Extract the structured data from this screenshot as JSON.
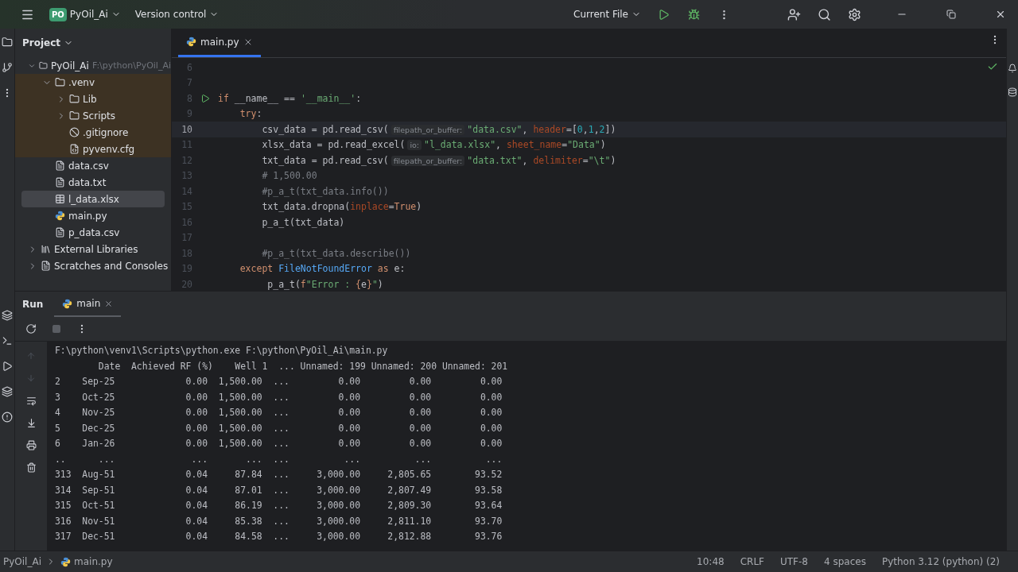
{
  "title_bar": {
    "project_badge": "PO",
    "project": "PyOil_Ai",
    "vcs": "Version control",
    "run_config": "Current File"
  },
  "project_panel": {
    "title": "Project",
    "tree": [
      {
        "label": "PyOil_Ai",
        "path": "F:\\python\\PyOil_Ai",
        "kind": "folder",
        "expanded": true,
        "selected": false,
        "excluded": false,
        "children": [
          {
            "label": ".venv",
            "kind": "folder",
            "expanded": true,
            "selected": false,
            "excluded": true,
            "children": [
              {
                "label": "Lib",
                "kind": "folder",
                "expanded": false,
                "selected": false,
                "excluded": true
              },
              {
                "label": "Scripts",
                "kind": "folder",
                "expanded": false,
                "selected": false,
                "excluded": true
              },
              {
                "label": ".gitignore",
                "kind": "ignore",
                "selected": false,
                "excluded": true
              },
              {
                "label": "pyvenv.cfg",
                "kind": "cfg",
                "selected": false,
                "excluded": true
              }
            ]
          },
          {
            "label": "data.csv",
            "kind": "text",
            "selected": false,
            "excluded": false
          },
          {
            "label": "data.txt",
            "kind": "text",
            "selected": false,
            "excluded": false
          },
          {
            "label": "l_data.xlsx",
            "kind": "table",
            "selected": true,
            "excluded": false
          },
          {
            "label": "main.py",
            "kind": "python",
            "selected": false,
            "excluded": false
          },
          {
            "label": "p_data.csv",
            "kind": "text",
            "selected": false,
            "excluded": false
          }
        ]
      },
      {
        "label": "External Libraries",
        "kind": "library",
        "expanded": false,
        "selected": false,
        "excluded": false
      },
      {
        "label": "Scratches and Consoles",
        "kind": "scratch",
        "expanded": false,
        "selected": false,
        "excluded": false
      }
    ]
  },
  "editor": {
    "tabs": [
      {
        "label": "main.py",
        "selected": true
      }
    ],
    "lines": [
      {
        "number": "6",
        "current": false,
        "run": false
      },
      {
        "number": "7",
        "current": false,
        "run": false
      },
      {
        "number": "8",
        "current": false,
        "run": true,
        "tokens": [
          {
            "kind": "kw",
            "text": "if "
          },
          {
            "kind": "plain",
            "text": "__name__ == "
          },
          {
            "kind": "str",
            "text": "'__main__'"
          },
          {
            "kind": "plain",
            "text": ":"
          }
        ]
      },
      {
        "number": "9",
        "current": false,
        "run": false,
        "tokens": [
          {
            "kind": "kw",
            "text": "    try"
          },
          {
            "kind": "plain",
            "text": ":"
          }
        ]
      },
      {
        "number": "10",
        "current": true,
        "run": false,
        "tokens": [
          {
            "kind": "plain",
            "text": "        csv_data = pd.read_csv("
          },
          {
            "kind": "hint",
            "text": "filepath_or_buffer:"
          },
          {
            "kind": "str",
            "text": "\"data.csv\""
          },
          {
            "kind": "plain",
            "text": ", "
          },
          {
            "kind": "param",
            "text": "header"
          },
          {
            "kind": "plain",
            "text": "=["
          },
          {
            "kind": "num",
            "text": "0"
          },
          {
            "kind": "plain",
            "text": ","
          },
          {
            "kind": "num",
            "text": "1"
          },
          {
            "kind": "plain",
            "text": ","
          },
          {
            "kind": "num",
            "text": "2"
          },
          {
            "kind": "plain",
            "text": "])"
          }
        ]
      },
      {
        "number": "11",
        "current": false,
        "run": false,
        "tokens": [
          {
            "kind": "plain",
            "text": "        xlsx_data = pd.read_excel("
          },
          {
            "kind": "hint",
            "text": "io:"
          },
          {
            "kind": "str",
            "text": "\"l_data.xlsx\""
          },
          {
            "kind": "plain",
            "text": ", "
          },
          {
            "kind": "param",
            "text": "sheet_name"
          },
          {
            "kind": "plain",
            "text": "="
          },
          {
            "kind": "str",
            "text": "\"Data\""
          },
          {
            "kind": "plain",
            "text": ")"
          }
        ]
      },
      {
        "number": "12",
        "current": false,
        "run": false,
        "tokens": [
          {
            "kind": "plain",
            "text": "        txt_data = pd.read_csv("
          },
          {
            "kind": "hint",
            "text": "filepath_or_buffer:"
          },
          {
            "kind": "str",
            "text": "\"data.txt\""
          },
          {
            "kind": "plain",
            "text": ", "
          },
          {
            "kind": "param",
            "text": "delimiter"
          },
          {
            "kind": "plain",
            "text": "="
          },
          {
            "kind": "str",
            "text": "\"\\t\""
          },
          {
            "kind": "plain",
            "text": ")"
          }
        ]
      },
      {
        "number": "13",
        "current": false,
        "run": false,
        "tokens": [
          {
            "kind": "comment",
            "text": "        # 1,500.00"
          }
        ]
      },
      {
        "number": "14",
        "current": false,
        "run": false,
        "tokens": [
          {
            "kind": "comment",
            "text": "        #p_a_t(txt_data.info())"
          }
        ]
      },
      {
        "number": "15",
        "current": false,
        "run": false,
        "tokens": [
          {
            "kind": "plain",
            "text": "        txt_data.dropna("
          },
          {
            "kind": "param",
            "text": "inplace"
          },
          {
            "kind": "plain",
            "text": "="
          },
          {
            "kind": "kw",
            "text": "True"
          },
          {
            "kind": "plain",
            "text": ")"
          }
        ]
      },
      {
        "number": "16",
        "current": false,
        "run": false,
        "tokens": [
          {
            "kind": "plain",
            "text": "        p_a_t(txt_data)"
          }
        ]
      },
      {
        "number": "17",
        "current": false,
        "run": false
      },
      {
        "number": "18",
        "current": false,
        "run": false,
        "tokens": [
          {
            "kind": "comment",
            "text": "        #p_a_t(txt_data.describe())"
          }
        ]
      },
      {
        "number": "19",
        "current": false,
        "run": false,
        "tokens": [
          {
            "kind": "kw",
            "text": "    except "
          },
          {
            "kind": "cls",
            "text": "FileNotFoundError"
          },
          {
            "kind": "kw",
            "text": " as "
          },
          {
            "kind": "plain",
            "text": "e:"
          }
        ]
      },
      {
        "number": "20",
        "current": false,
        "run": false,
        "tokens": [
          {
            "kind": "plain",
            "text": "         p_a_t("
          },
          {
            "kind": "kw",
            "text": "f"
          },
          {
            "kind": "str",
            "text": "\"Error : "
          },
          {
            "kind": "kw",
            "text": "{"
          },
          {
            "kind": "plain",
            "text": "e"
          },
          {
            "kind": "kw",
            "text": "}"
          },
          {
            "kind": "str",
            "text": "\""
          },
          {
            "kind": "plain",
            "text": ")"
          }
        ]
      }
    ]
  },
  "run_panel": {
    "title": "Run",
    "tabs": [
      {
        "label": "main",
        "selected": true
      }
    ],
    "output": [
      "F:\\python\\venv1\\Scripts\\python.exe F:\\python\\PyOil_Ai\\main.py",
      "        Date  Achieved RF (%)    Well 1  ... Unnamed: 199 Unnamed: 200 Unnamed: 201",
      "2    Sep-25             0.00  1,500.00  ...         0.00         0.00         0.00",
      "3    Oct-25             0.00  1,500.00  ...         0.00         0.00         0.00",
      "4    Nov-25             0.00  1,500.00  ...         0.00         0.00         0.00",
      "5    Dec-25             0.00  1,500.00  ...         0.00         0.00         0.00",
      "6    Jan-26             0.00  1,500.00  ...         0.00         0.00         0.00",
      "..      ...              ...       ...  ...          ...          ...          ...",
      "313  Aug-51             0.04     87.84  ...     3,000.00     2,805.65        93.52",
      "314  Sep-51             0.04     87.01  ...     3,000.00     2,807.49        93.58",
      "315  Oct-51             0.04     86.19  ...     3,000.00     2,809.30        93.64",
      "316  Nov-51             0.04     85.38  ...     3,000.00     2,811.10        93.70",
      "317  Dec-51             0.04     84.58  ...     3,000.00     2,812.88        93.76"
    ]
  },
  "status_bar": {
    "breadcrumbs": [
      "PyOil_Ai",
      "main.py"
    ],
    "items": [
      "10:48",
      "CRLF",
      "UTF-8",
      "4 spaces",
      "Python 3.12 (python) (2)"
    ]
  }
}
